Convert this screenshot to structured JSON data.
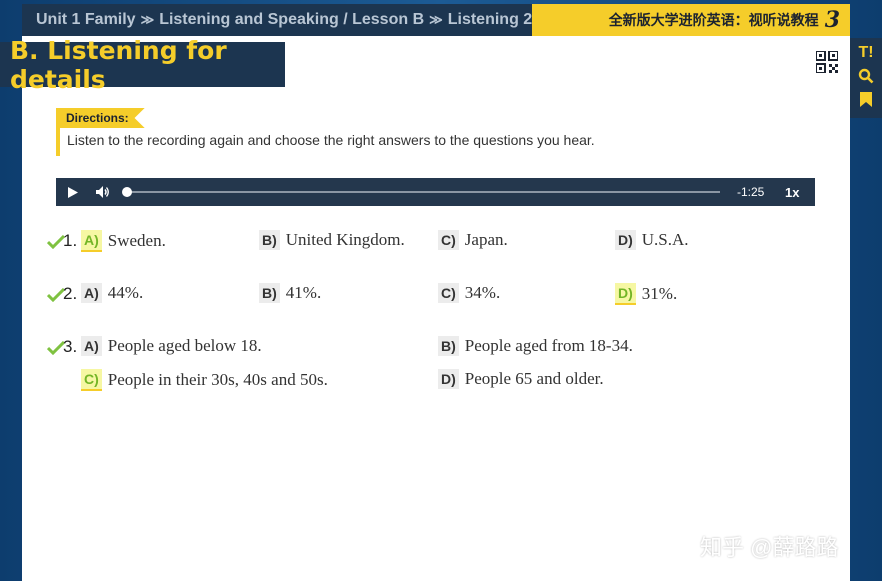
{
  "header": {
    "breadcrumb": [
      "Unit 1 Family",
      "Listening and Speaking / Lesson B",
      "Listening 2"
    ],
    "separator": "≫",
    "book_title": "全新版大学进阶英语：视听说教程",
    "book_number": "3"
  },
  "section": {
    "title": "B. Listening for details"
  },
  "side_tools": [
    "T!",
    "search",
    "bookmark"
  ],
  "directions": {
    "tag": "Directions:",
    "text": "Listen to the recording again and choose the right answers to the questions you hear."
  },
  "player": {
    "time": "-1:25",
    "speed": "1x",
    "progress": 0
  },
  "questions": [
    {
      "number": "1.",
      "correct": true,
      "options": [
        {
          "letter": "A)",
          "text": "Sweden.",
          "selected": true
        },
        {
          "letter": "B)",
          "text": "United Kingdom.",
          "selected": false
        },
        {
          "letter": "C)",
          "text": "Japan.",
          "selected": false
        },
        {
          "letter": "D)",
          "text": "U.S.A.",
          "selected": false
        }
      ]
    },
    {
      "number": "2.",
      "correct": true,
      "options": [
        {
          "letter": "A)",
          "text": "44%.",
          "selected": false
        },
        {
          "letter": "B)",
          "text": "41%.",
          "selected": false
        },
        {
          "letter": "C)",
          "text": "34%.",
          "selected": false
        },
        {
          "letter": "D)",
          "text": "31%.",
          "selected": true
        }
      ]
    },
    {
      "number": "3.",
      "correct": true,
      "options": [
        {
          "letter": "A)",
          "text": "People aged below 18.",
          "selected": false
        },
        {
          "letter": "B)",
          "text": "People aged from 18-34.",
          "selected": false
        },
        {
          "letter": "C)",
          "text": "People in their 30s, 40s and 50s.",
          "selected": true
        },
        {
          "letter": "D)",
          "text": "People 65 and older.",
          "selected": false
        }
      ]
    }
  ],
  "watermark": "知乎 @薛路路",
  "colors": {
    "accent": "#f5cd2a",
    "navy": "#1c3550",
    "check": "#7fc241"
  }
}
